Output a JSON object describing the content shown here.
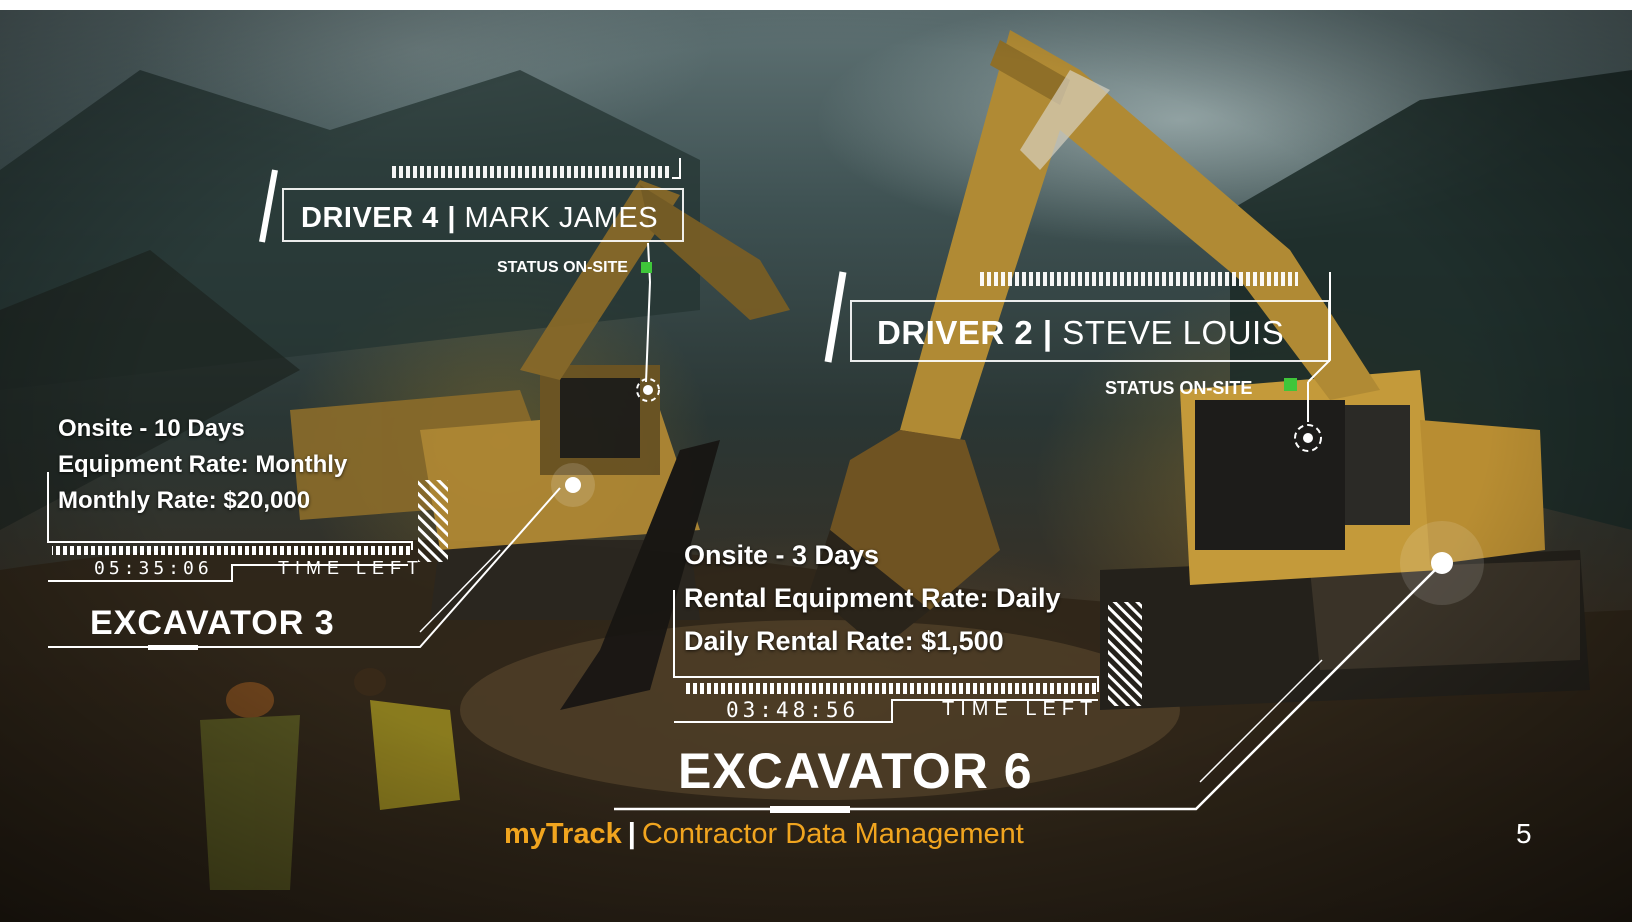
{
  "driver_tags": [
    {
      "driver": "DRIVER 4",
      "separator": "|",
      "name": "MARK JAMES",
      "status": "STATUS ON-SITE",
      "status_color": "#3fc63a"
    },
    {
      "driver": "DRIVER 2",
      "separator": "|",
      "name": "STEVE LOUIS",
      "status": "STATUS ON-SITE",
      "status_color": "#3fc63a"
    }
  ],
  "equipment_cards": [
    {
      "lines": [
        "Onsite - 10 Days",
        "Equipment Rate: Monthly",
        "Monthly Rate: $20,000"
      ],
      "timer": "05:35:06",
      "time_left_label": "TIME LEFT",
      "title": "EXCAVATOR 3"
    },
    {
      "lines": [
        "Onsite - 3 Days",
        "Rental Equipment Rate: Daily",
        "Daily Rental Rate: $1,500"
      ],
      "timer": "03:48:56",
      "time_left_label": "TIME LEFT",
      "title": "EXCAVATOR 6"
    }
  ],
  "footer": {
    "brand": "myTrack",
    "separator": "|",
    "subtitle": "Contractor Data Management",
    "brand_color": "#f1a51f"
  },
  "page_number": "5"
}
